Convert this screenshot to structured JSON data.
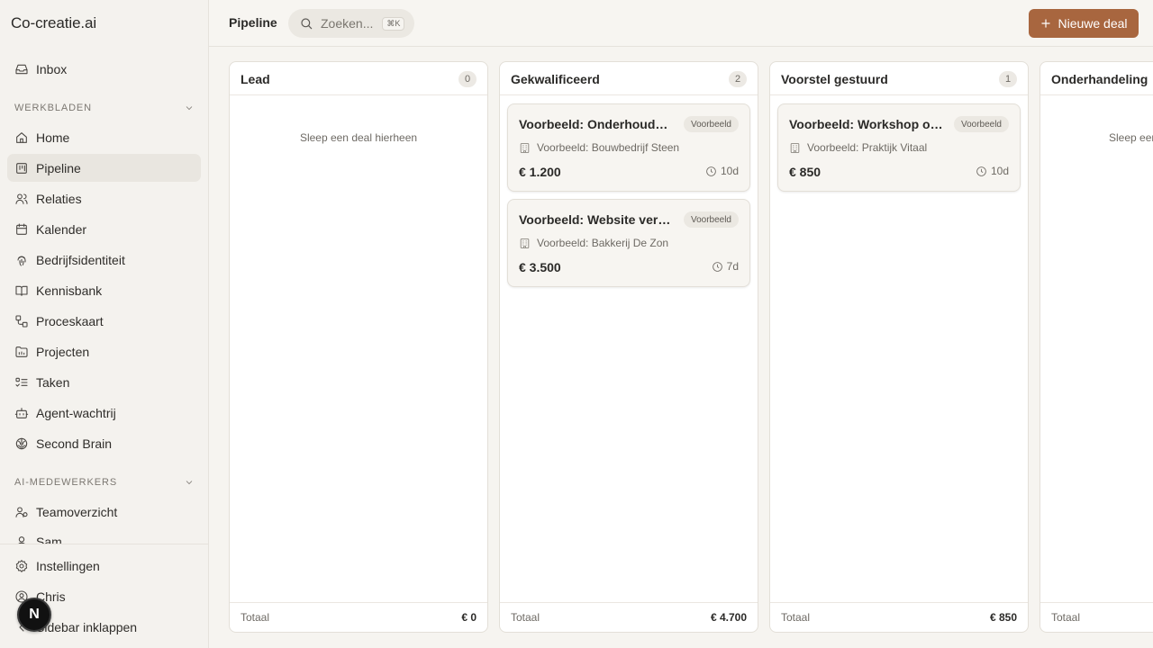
{
  "app": {
    "brand": "Co-creatie.ai"
  },
  "sidebar": {
    "inbox": "Inbox",
    "section_werkbladen": "WERKBLADEN",
    "items": [
      {
        "label": "Home",
        "icon": "home-icon"
      },
      {
        "label": "Pipeline",
        "icon": "kanban-icon",
        "active": true
      },
      {
        "label": "Relaties",
        "icon": "users-icon"
      },
      {
        "label": "Kalender",
        "icon": "calendar-icon"
      },
      {
        "label": "Bedrijfsidentiteit",
        "icon": "fingerprint-icon"
      },
      {
        "label": "Kennisbank",
        "icon": "book-icon"
      },
      {
        "label": "Proceskaart",
        "icon": "workflow-icon"
      },
      {
        "label": "Projecten",
        "icon": "folder-icon"
      },
      {
        "label": "Taken",
        "icon": "list-todo-icon"
      },
      {
        "label": "Agent-wachtrij",
        "icon": "bot-icon"
      },
      {
        "label": "Second Brain",
        "icon": "brain-icon"
      }
    ],
    "section_ai": "AI-MEDEWERKERS",
    "ai_items": [
      {
        "label": "Teamoverzicht",
        "icon": "team-icon"
      },
      {
        "label": "Sam",
        "icon": "user-icon"
      }
    ],
    "footer": {
      "settings": "Instellingen",
      "user": "Chris",
      "collapse": "Sidebar inklappen",
      "badge": "N"
    }
  },
  "header": {
    "title": "Pipeline",
    "search_placeholder": "Zoeken...",
    "search_shortcut": "⌘K",
    "new_deal": "Nieuwe deal"
  },
  "board": {
    "empty_text": "Sleep een deal hierheen",
    "total_label": "Totaal",
    "columns": [
      {
        "title": "Lead",
        "count": "0",
        "total": "€ 0",
        "cards": []
      },
      {
        "title": "Gekwalificeerd",
        "count": "2",
        "total": "€ 4.700",
        "cards": [
          {
            "title": "Voorbeeld: Onderhoudscontract",
            "tag": "Voorbeeld",
            "company": "Voorbeeld: Bouwbedrijf Steen",
            "amount": "€ 1.200",
            "age": "10d"
          },
          {
            "title": "Voorbeeld: Website vernieuwing",
            "tag": "Voorbeeld",
            "company": "Voorbeeld: Bakkerij De Zon",
            "amount": "€ 3.500",
            "age": "7d"
          }
        ]
      },
      {
        "title": "Voorstel gestuurd",
        "count": "1",
        "total": "€ 850",
        "cards": [
          {
            "title": "Voorbeeld: Workshop op maat",
            "tag": "Voorbeeld",
            "company": "Voorbeeld: Praktijk Vitaal",
            "amount": "€ 850",
            "age": "10d"
          }
        ]
      },
      {
        "title": "Onderhandeling",
        "count": "",
        "total": "",
        "cards": []
      }
    ]
  }
}
